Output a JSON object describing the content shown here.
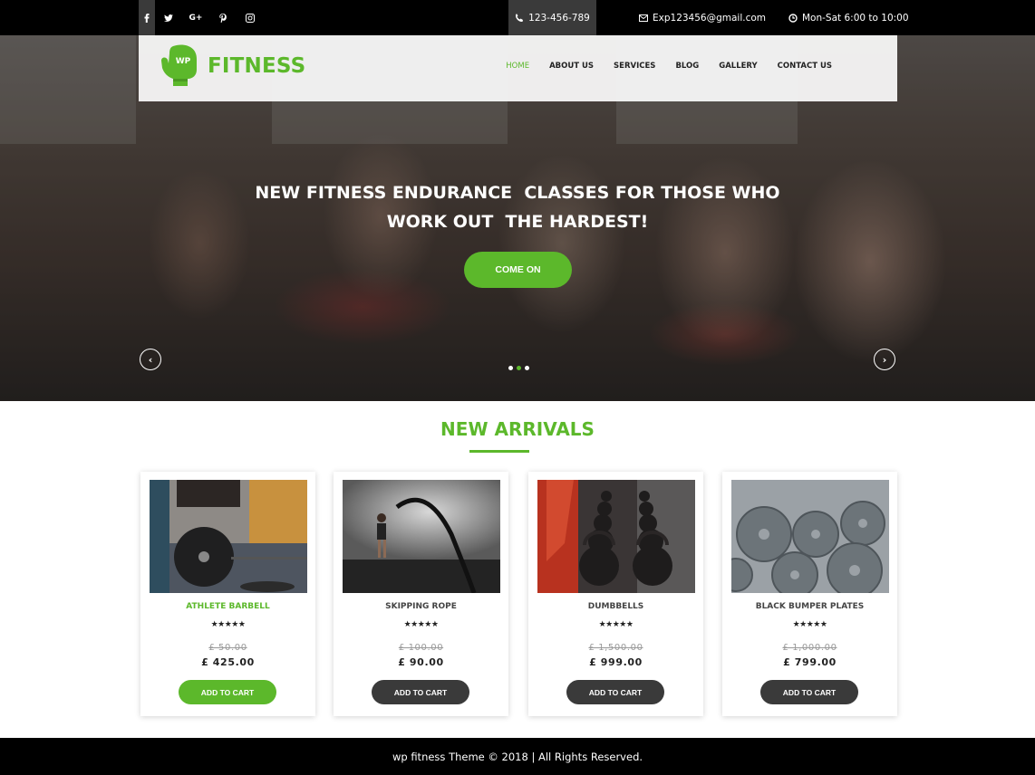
{
  "topbar": {
    "social": [
      {
        "icon": "facebook-icon",
        "glyph": "f"
      },
      {
        "icon": "twitter-icon",
        "glyph": "t"
      },
      {
        "icon": "google-plus-icon",
        "glyph": "G+"
      },
      {
        "icon": "pinterest-icon",
        "glyph": "p"
      },
      {
        "icon": "instagram-icon",
        "glyph": "ig"
      }
    ],
    "phone": "123-456-789",
    "email": "Exp123456@gmail.com",
    "hours": "Mon-Sat 6:00 to 10:00"
  },
  "header": {
    "logo_badge": "WP",
    "logo_text": "FITNESS",
    "nav": [
      "HOME",
      "ABOUT US",
      "SERVICES",
      "BLOG",
      "GALLERY",
      "CONTACT US"
    ],
    "active_nav": "HOME"
  },
  "hero": {
    "title_line1": "NEW FITNESS ENDURANCE  CLASSES FOR THOSE WHO",
    "title_line2": "WORK OUT  THE HARDEST!",
    "button": "COME ON",
    "prev_icon": "‹",
    "next_icon": "›",
    "slides": 3,
    "active_slide": 2
  },
  "arrivals": {
    "title": "NEW ARRIVALS",
    "products": [
      {
        "name": "ATHLETE BARBELL",
        "rating": 5,
        "stars": "★★★★★",
        "old_price": "£ 50.00",
        "price": "£ 425.00",
        "button": "ADD TO CART",
        "highlighted": true
      },
      {
        "name": "SKIPPING ROPE",
        "rating": 5,
        "stars": "★★★★★",
        "old_price": "£ 100.00",
        "price": "£ 90.00",
        "button": "ADD TO CART",
        "highlighted": false
      },
      {
        "name": "DUMBBELLS",
        "rating": 5,
        "stars": "★★★★★",
        "old_price": "£ 1,500.00",
        "price": "£ 999.00",
        "button": "ADD TO CART",
        "highlighted": false
      },
      {
        "name": "BLACK BUMPER PLATES",
        "rating": 5,
        "stars": "★★★★★",
        "old_price": "£ 1,000.00",
        "price": "£ 799.00",
        "button": "ADD TO CART",
        "highlighted": false
      }
    ]
  },
  "footer": {
    "text": "wp fitness Theme © 2018 | All Rights Reserved."
  },
  "colors": {
    "accent": "#5cb82b",
    "dark_button": "#3a3a3a",
    "topbar": "#000000"
  }
}
